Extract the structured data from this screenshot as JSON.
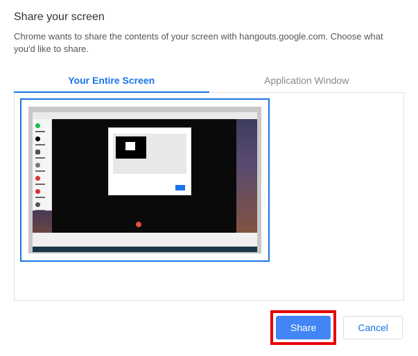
{
  "dialog": {
    "title": "Share your screen",
    "description": "Chrome wants to share the contents of your screen with hangouts.google.com. Choose what you'd like to share."
  },
  "tabs": {
    "entire_screen": "Your Entire Screen",
    "application_window": "Application Window"
  },
  "buttons": {
    "share": "Share",
    "cancel": "Cancel"
  }
}
